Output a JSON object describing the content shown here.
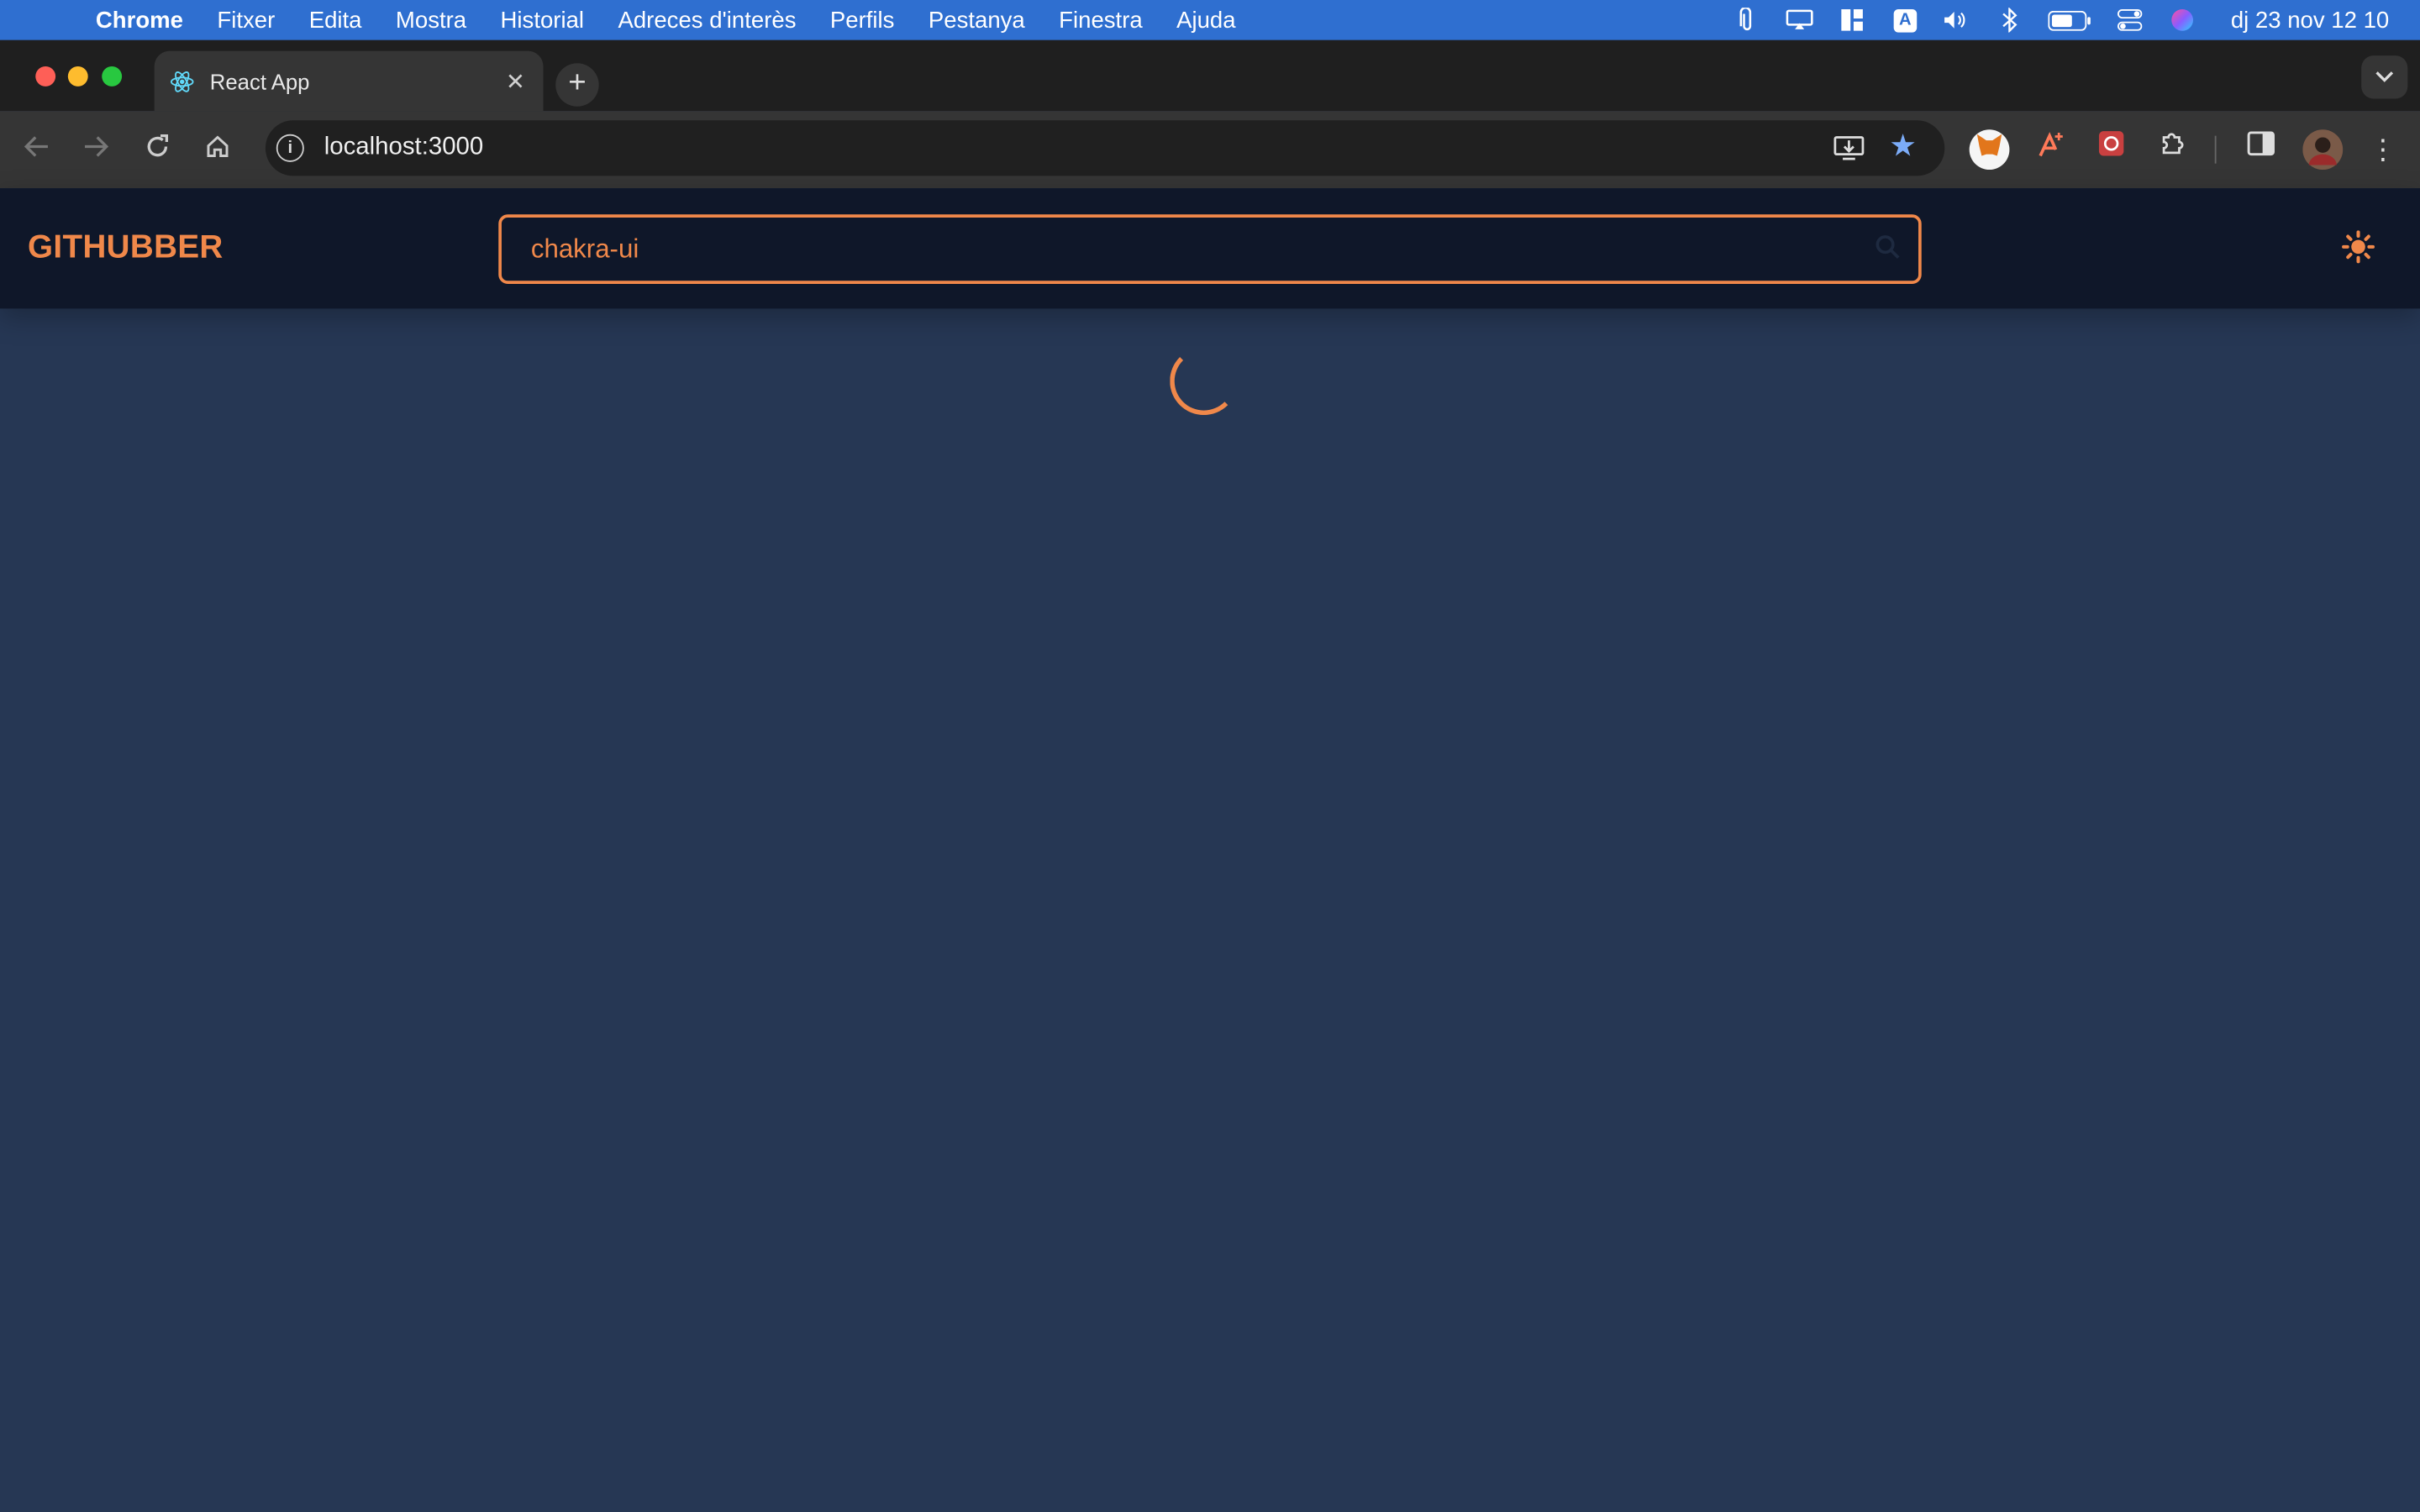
{
  "mac_menu_bar": {
    "apple": "",
    "items": [
      "Chrome",
      "Fitxer",
      "Edita",
      "Mostra",
      "Historial",
      "Adreces d'interès",
      "Perfils",
      "Pestanya",
      "Finestra",
      "Ajuda"
    ],
    "status_icons": [
      "paperclip-icon",
      "screen-mirror-icon",
      "layout-icon",
      "input-source-icon",
      "volume-icon",
      "bluetooth-icon",
      "battery-icon",
      "control-center-icon",
      "siri-icon"
    ],
    "input_source_label": "A",
    "clock": "dj 23 nov  12 10"
  },
  "browser": {
    "tab_title": "React App",
    "tab_close": "✕",
    "new_tab": "+",
    "url": "localhost:3000",
    "info_glyph": "i"
  },
  "app": {
    "brand": "GITHUBBER",
    "search": {
      "value": "chakra-ui",
      "placeholder": ""
    },
    "accent_color": "#f0884a",
    "background_color": "#263754",
    "header_color": "#0f1729",
    "loading": true
  }
}
